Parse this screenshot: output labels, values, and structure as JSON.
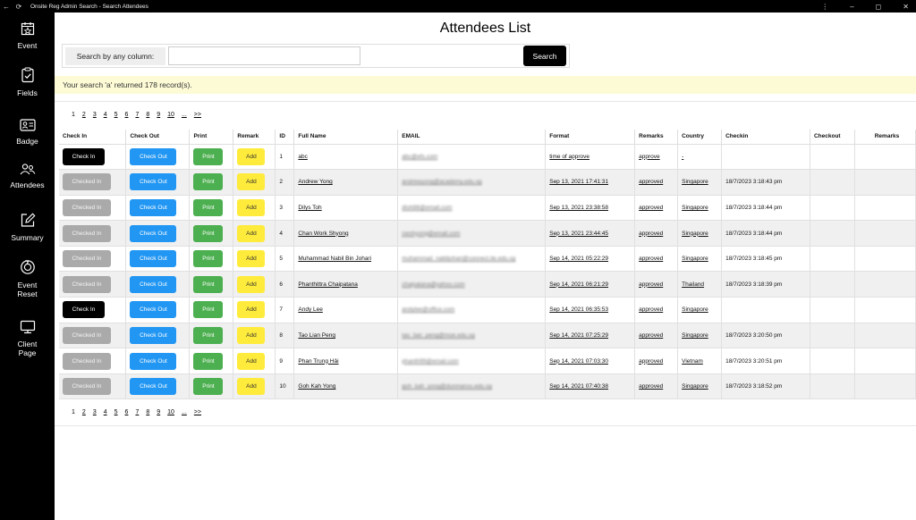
{
  "window": {
    "title": "Onsite Reg Admin Search - Search Attendees",
    "more_glyph": "⋮",
    "min_glyph": "–",
    "max_glyph": "◻",
    "close_glyph": "✕",
    "back_glyph": "←",
    "refresh_glyph": "⟳"
  },
  "sidebar": {
    "items": [
      {
        "label": "Event",
        "icon": "calendar-star-icon"
      },
      {
        "label": "Fields",
        "icon": "clipboard-check-icon"
      },
      {
        "label": "Badge",
        "icon": "id-card-icon"
      },
      {
        "label": "Attendees",
        "icon": "people-icon"
      },
      {
        "label": "Summary",
        "icon": "edit-icon"
      },
      {
        "label_line1": "Event",
        "label_line2": "Reset",
        "icon": "reset-icon"
      },
      {
        "label_line1": "Client",
        "label_line2": "Page",
        "icon": "monitor-icon"
      }
    ]
  },
  "page": {
    "title": "Attendees List",
    "search_label": "Search by any column:",
    "search_value": "",
    "search_button": "Search",
    "result_text": "Your search 'a' returned 178 record(s)."
  },
  "pagination": [
    "1",
    "2",
    "3",
    "4",
    "5",
    "6",
    "7",
    "8",
    "9",
    "10",
    "...",
    ">>"
  ],
  "table": {
    "headers": [
      "Check In",
      "Check Out",
      "Print",
      "Remark",
      "ID",
      "Full Name",
      "EMAIL",
      "Format",
      "Remarks",
      "Country",
      "Checkin",
      "Checkout",
      "Remarks"
    ],
    "rows": [
      {
        "checkin_btn": "Check In",
        "checked": false,
        "checkout_btn": "Check Out",
        "print_btn": "Print",
        "remark_btn": "Add",
        "id": "1",
        "name": "abc",
        "email": "abc@efs.com",
        "format": "time of approve",
        "remarks": "approve",
        "country": "-",
        "checkin": "",
        "checkout": "",
        "remarks2": ""
      },
      {
        "checkin_btn": "Checked In",
        "checked": true,
        "checkout_btn": "Check Out",
        "print_btn": "Print",
        "remark_btn": "Add",
        "id": "2",
        "name": "Andrew Yong",
        "email": "andrewyong@academy.edu.sg",
        "format": "Sep 13, 2021 17:41:31",
        "remarks": "approved",
        "country": "Singapore",
        "checkin": "18/7/2023 3:18:43 pm",
        "checkout": "",
        "remarks2": ""
      },
      {
        "checkin_btn": "Checked In",
        "checked": true,
        "checkout_btn": "Check Out",
        "print_btn": "Print",
        "remark_btn": "Add",
        "id": "3",
        "name": "Dilys Toh",
        "email": "dtoh88@email.com",
        "format": "Sep 13, 2021 23:38:58",
        "remarks": "approved",
        "country": "Singapore",
        "checkin": "18/7/2023 3:18:44 pm",
        "checkout": "",
        "remarks2": ""
      },
      {
        "checkin_btn": "Checked In",
        "checked": true,
        "checkout_btn": "Check Out",
        "print_btn": "Print",
        "remark_btn": "Add",
        "id": "4",
        "name": "Chan Work Shyong",
        "email": "cwshyong@email.com",
        "format": "Sep 13, 2021 23:44:45",
        "remarks": "approved",
        "country": "Singapore",
        "checkin": "18/7/2023 3:18:44 pm",
        "checkout": "",
        "remarks2": ""
      },
      {
        "checkin_btn": "Checked In",
        "checked": true,
        "checkout_btn": "Check Out",
        "print_btn": "Print",
        "remark_btn": "Add",
        "id": "5",
        "name": "Muhammad Nabil Bin Johari",
        "email": "muhammad_nabiljohari@connect.ite.edu.sg",
        "format": "Sep 14, 2021 05:22:29",
        "remarks": "approved",
        "country": "Singapore",
        "checkin": "18/7/2023 3:18:45 pm",
        "checkout": "",
        "remarks2": ""
      },
      {
        "checkin_btn": "Checked In",
        "checked": true,
        "checkout_btn": "Check Out",
        "print_btn": "Print",
        "remark_btn": "Add",
        "id": "6",
        "name": "Phanthittra Chaipatana",
        "email": "chaipatana@yahoo.com",
        "format": "Sep 14, 2021 06:21:29",
        "remarks": "approved",
        "country": "Thailand",
        "checkin": "18/7/2023 3:18:39 pm",
        "checkout": "",
        "remarks2": ""
      },
      {
        "checkin_btn": "Check In",
        "checked": false,
        "checkout_btn": "Check Out",
        "print_btn": "Print",
        "remark_btn": "Add",
        "id": "7",
        "name": "Andy Lee",
        "email": "andylee@office.com",
        "format": "Sep 14, 2021 06:35:53",
        "remarks": "approved",
        "country": "Singapore",
        "checkin": "",
        "checkout": "",
        "remarks2": ""
      },
      {
        "checkin_btn": "Checked In",
        "checked": true,
        "checkout_btn": "Check Out",
        "print_btn": "Print",
        "remark_btn": "Add",
        "id": "8",
        "name": "Tao Lian Peng",
        "email": "tao_lian_peng@moe.edu.sg",
        "format": "Sep 14, 2021 07:25:29",
        "remarks": "approved",
        "country": "Singapore",
        "checkin": "18/7/2023 3:20:50 pm",
        "checkout": "",
        "remarks2": ""
      },
      {
        "checkin_btn": "Checked In",
        "checked": true,
        "checkout_btn": "Check Out",
        "print_btn": "Print",
        "remark_btn": "Add",
        "id": "9",
        "name": "Phan Trung Hải",
        "email": "phanth99@email.com",
        "format": "Sep 14, 2021 07:03:30",
        "remarks": "approved",
        "country": "Vietnam",
        "checkin": "18/7/2023 3:20:51 pm",
        "checkout": "",
        "remarks2": ""
      },
      {
        "checkin_btn": "Checked In",
        "checked": true,
        "checkout_btn": "Check Out",
        "print_btn": "Print",
        "remark_btn": "Add",
        "id": "10",
        "name": "Goh Kah Yong",
        "email": "goh_kah_yong@dunmanss.edu.sg",
        "format": "Sep 14, 2021 07:40:38",
        "remarks": "approved",
        "country": "Singapore",
        "checkin": "18/7/2023 3:18:52 pm",
        "checkout": "",
        "remarks2": ""
      }
    ]
  },
  "colors": {
    "checkin": "#000000",
    "checked_in": "#aaaaaa",
    "checkout": "#2196f3",
    "print": "#4caf50",
    "add": "#ffeb3b",
    "result_bg": "#fdfbd6"
  }
}
